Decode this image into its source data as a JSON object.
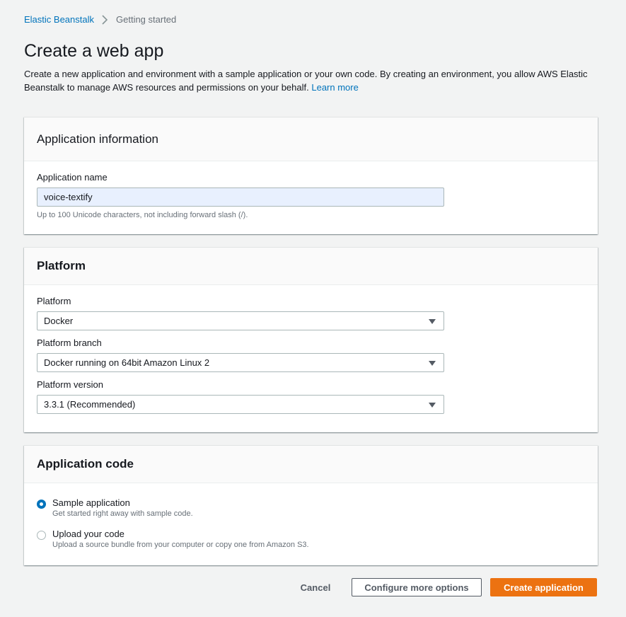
{
  "breadcrumb": {
    "root": "Elastic Beanstalk",
    "current": "Getting started"
  },
  "page": {
    "title": "Create a web app",
    "description": "Create a new application and environment with a sample application or your own code. By creating an environment, you allow AWS Elastic Beanstalk to manage AWS resources and permissions on your behalf.",
    "learn_more": "Learn more"
  },
  "app_info": {
    "header": "Application information",
    "name_label": "Application name",
    "name_value": "voice-textify",
    "name_hint": "Up to 100 Unicode characters, not including forward slash (/)."
  },
  "platform": {
    "header": "Platform",
    "platform_label": "Platform",
    "platform_value": "Docker",
    "branch_label": "Platform branch",
    "branch_value": "Docker running on 64bit Amazon Linux 2",
    "version_label": "Platform version",
    "version_value": "3.3.1 (Recommended)"
  },
  "app_code": {
    "header": "Application code",
    "options": [
      {
        "title": "Sample application",
        "subtitle": "Get started right away with sample code.",
        "checked": true
      },
      {
        "title": "Upload your code",
        "subtitle": "Upload a source bundle from your computer or copy one from Amazon S3.",
        "checked": false
      }
    ]
  },
  "actions": {
    "cancel": "Cancel",
    "configure": "Configure more options",
    "create": "Create application"
  },
  "colors": {
    "link": "#0073bb",
    "primary_button": "#ec7211",
    "background": "#f2f3f3"
  },
  "icons": {
    "breadcrumb_separator": "chevron-right-icon",
    "select_caret": "caret-down-icon"
  }
}
